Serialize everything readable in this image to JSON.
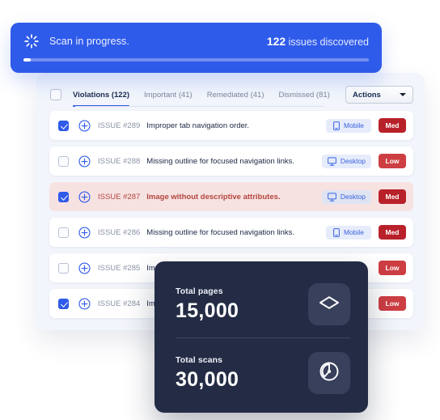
{
  "banner": {
    "spinner_icon": "spinner-icon",
    "status_text": "Scan in progress.",
    "issues_count": "122",
    "issues_suffix": " issues discovered",
    "progress_percent": 2,
    "accent_color": "#2f5bea"
  },
  "toolbar": {
    "select_all_checked": false,
    "tabs": [
      {
        "label": "Violations (122)",
        "active": true
      },
      {
        "label": "Important (41)",
        "active": false
      },
      {
        "label": "Remediated (41)",
        "active": false
      },
      {
        "label": "Dismissed (81)",
        "active": false
      }
    ],
    "actions_label": "Actions",
    "actions_caret_icon": "chevron-down-icon"
  },
  "issues": [
    {
      "checked": true,
      "expand_icon": "plus-circle-icon",
      "id": "ISSUE #289",
      "title": "Improper tab navigation order.",
      "device": "Mobile",
      "device_icon": "mobile-icon",
      "severity": "Med",
      "severity_level": "med",
      "flagged": false
    },
    {
      "checked": false,
      "expand_icon": "plus-circle-icon",
      "id": "ISSUE #288",
      "title": "Missing outline for focused navigation links.",
      "device": "Desktop",
      "device_icon": "desktop-icon",
      "severity": "Low",
      "severity_level": "low",
      "flagged": false
    },
    {
      "checked": true,
      "expand_icon": "plus-circle-icon",
      "id": "ISSUE #287",
      "title": "Image without descriptive attributes.",
      "device": "Desktop",
      "device_icon": "desktop-icon",
      "severity": "Med",
      "severity_level": "med",
      "flagged": true
    },
    {
      "checked": false,
      "expand_icon": "plus-circle-icon",
      "id": "ISSUE #286",
      "title": "Missing outline for focused navigation links.",
      "device": "Mobile",
      "device_icon": "mobile-icon",
      "severity": "Med",
      "severity_level": "med",
      "flagged": false
    },
    {
      "checked": false,
      "expand_icon": "plus-circle-icon",
      "id": "ISSUE #285",
      "title": "Improper tab navigation order.",
      "device": "",
      "device_icon": "",
      "severity": "Low",
      "severity_level": "low",
      "flagged": false
    },
    {
      "checked": true,
      "expand_icon": "plus-circle-icon",
      "id": "ISSUE #284",
      "title": "Improper tab navigation order.",
      "device": "",
      "device_icon": "",
      "severity": "Low",
      "severity_level": "low",
      "flagged": false
    }
  ],
  "stats_card": {
    "background_color": "#242c45",
    "items": [
      {
        "label": "Total pages",
        "value": "15,000",
        "icon": "diamond-icon"
      },
      {
        "label": "Total scans",
        "value": "30,000",
        "icon": "radar-scan-icon"
      }
    ]
  }
}
